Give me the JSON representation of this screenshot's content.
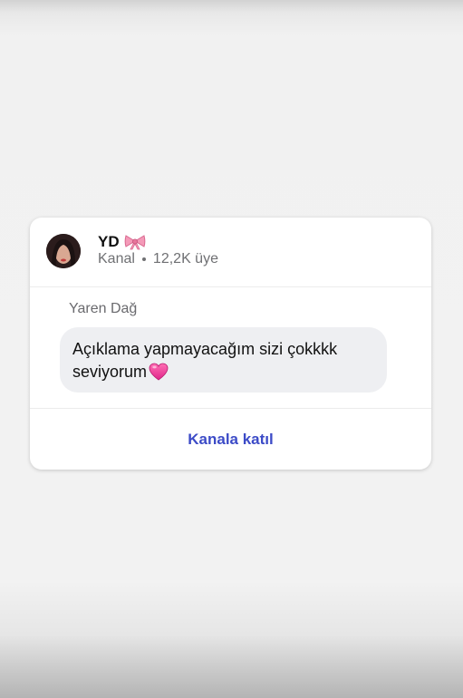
{
  "channel": {
    "name": "YD",
    "name_emoji": "ribbon-bow-icon",
    "type_label": "Kanal",
    "member_count": "12,2K üye"
  },
  "message": {
    "sender": "Yaren Dağ",
    "text": "Açıklama yapmayacağım sizi çokkkk seviyorum",
    "trailing_emoji": "pink-heart-icon"
  },
  "actions": {
    "join_label": "Kanala katıl"
  },
  "colors": {
    "accent": "#3c4bc7",
    "bubble_bg": "#eeeff2",
    "card_bg": "#ffffff",
    "heart": "#f0409a"
  }
}
